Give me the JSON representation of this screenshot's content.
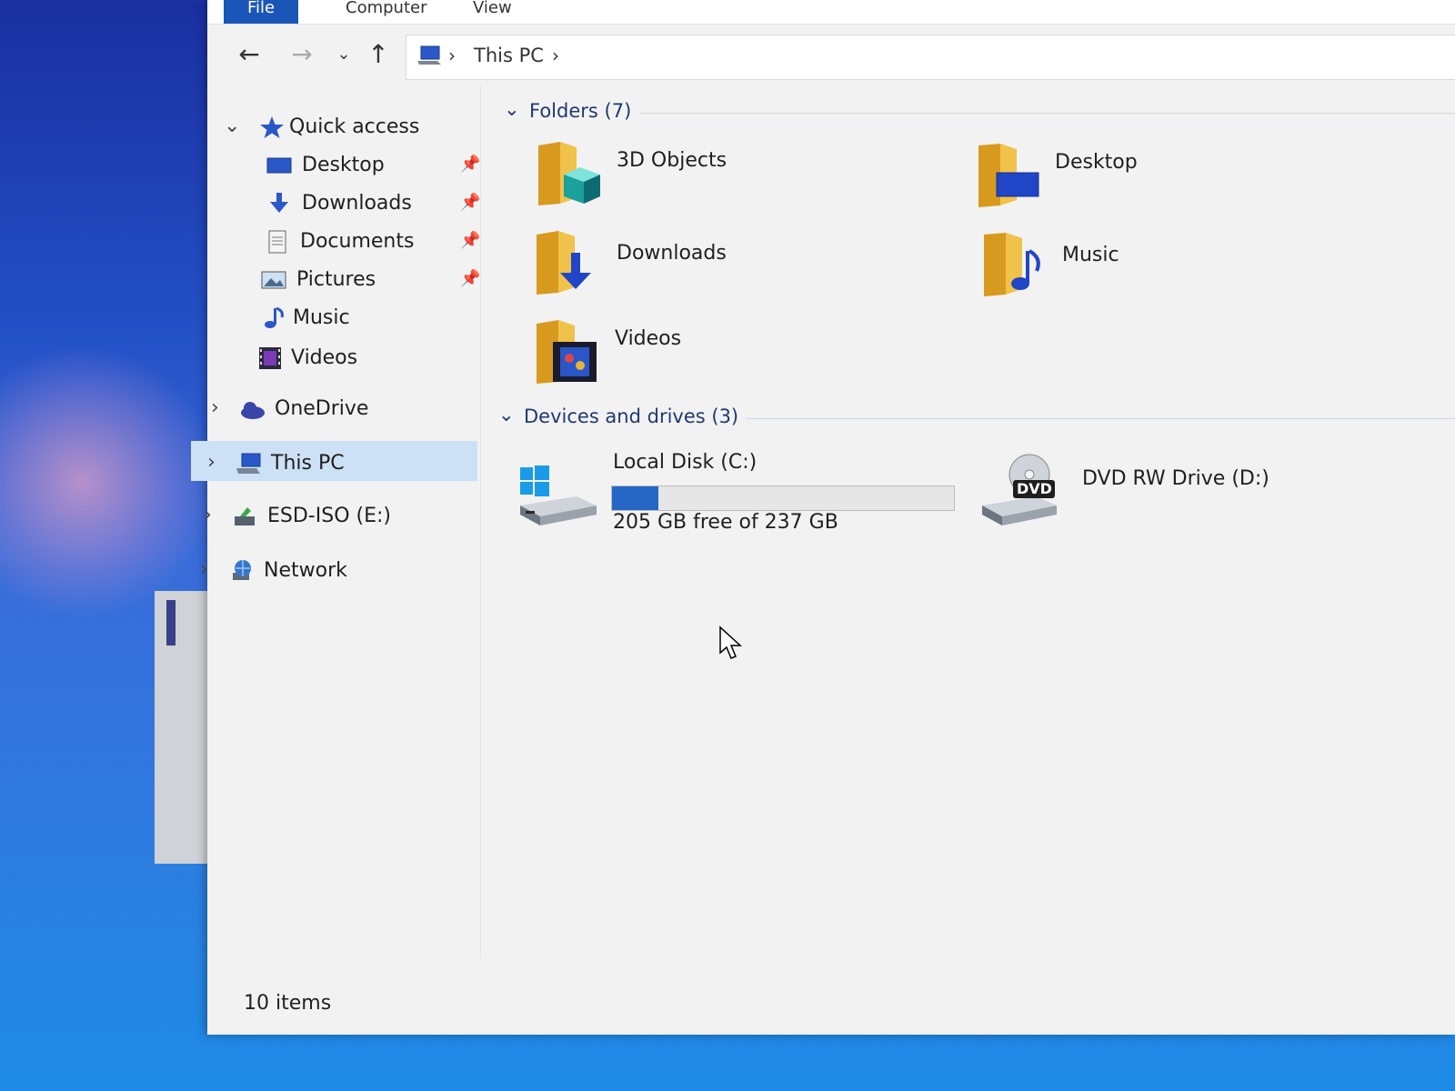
{
  "ribbon": {
    "tabs": [
      "File",
      "Computer",
      "View"
    ]
  },
  "address": {
    "path": "This PC"
  },
  "nav_pane": {
    "quick_access": "Quick access",
    "quick_items": [
      {
        "label": "Desktop",
        "icon": "desktop-icon",
        "pinned": true
      },
      {
        "label": "Downloads",
        "icon": "download-arrow-icon",
        "pinned": true
      },
      {
        "label": "Documents",
        "icon": "document-icon",
        "pinned": true
      },
      {
        "label": "Pictures",
        "icon": "picture-icon",
        "pinned": true
      },
      {
        "label": "Music",
        "icon": "music-note-icon",
        "pinned": false
      },
      {
        "label": "Videos",
        "icon": "film-icon",
        "pinned": false
      }
    ],
    "onedrive": "OneDrive",
    "this_pc": "This PC",
    "esd_iso": "ESD-ISO (E:)",
    "network": "Network"
  },
  "folders": {
    "header": "Folders (7)",
    "items": [
      {
        "label": "3D Objects",
        "icon": "3d-objects-folder-icon"
      },
      {
        "label": "Desktop",
        "icon": "desktop-folder-icon"
      },
      {
        "label": "Downloads",
        "icon": "downloads-folder-icon"
      },
      {
        "label": "Music",
        "icon": "music-folder-icon"
      },
      {
        "label": "Videos",
        "icon": "videos-folder-icon"
      }
    ]
  },
  "drives": {
    "header": "Devices and drives (3)",
    "local_disk": {
      "label": "Local Disk (C:)",
      "free_text": "205 GB free of 237 GB",
      "used_fraction": 0.135
    },
    "dvd": {
      "label": "DVD RW Drive (D:)",
      "badge": "DVD"
    }
  },
  "status": {
    "items": "10 items"
  },
  "colors": {
    "accent": "#2667c5",
    "selection": "#cce1f5",
    "folder": "#e8b534"
  }
}
